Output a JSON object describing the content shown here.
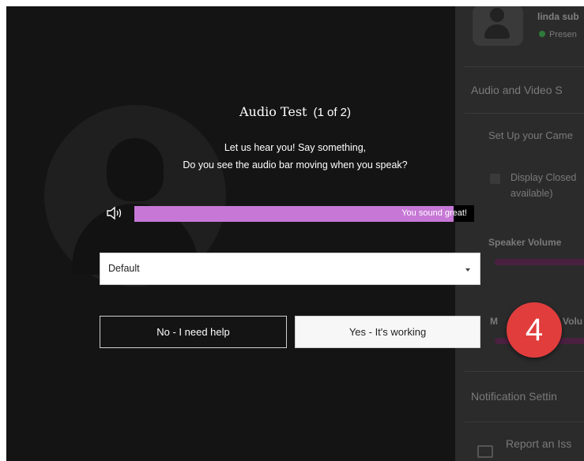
{
  "modal": {
    "title": "Audio Test",
    "step_counter": "(1 of 2)",
    "instruction_line1": "Let us hear you! Say something,",
    "instruction_line2": "Do you see the audio bar moving when you speak?",
    "audio_status": "You sound great!",
    "audio_level": 0.95,
    "device_select": {
      "selected": "Default"
    },
    "no_button": "No - I need help",
    "yes_button": "Yes - It's working"
  },
  "side_panel": {
    "user_name": "linda sub",
    "presence": "Presen",
    "section_audio_video": "Audio and Video S",
    "setup_camera": "Set Up your Came",
    "display_closed_captions": "Display Closed",
    "display_closed_captions_2": "available)",
    "speaker_volume": "Speaker Volume",
    "mic_volume_fragment": "Volu",
    "mic_volume_prefix": "M",
    "notification_settings": "Notification Settin",
    "report_issue": "Report an Iss"
  },
  "annotation": {
    "step_number": "4"
  },
  "colors": {
    "audio_bar": "#c778d6",
    "badge": "#e13d3d",
    "background": "#141414",
    "panel": "#2b2b2b"
  },
  "icons": {
    "speaker": "speaker-icon",
    "caret": "chevron-down-icon",
    "avatar": "user-avatar-icon",
    "report": "chat-report-icon"
  }
}
